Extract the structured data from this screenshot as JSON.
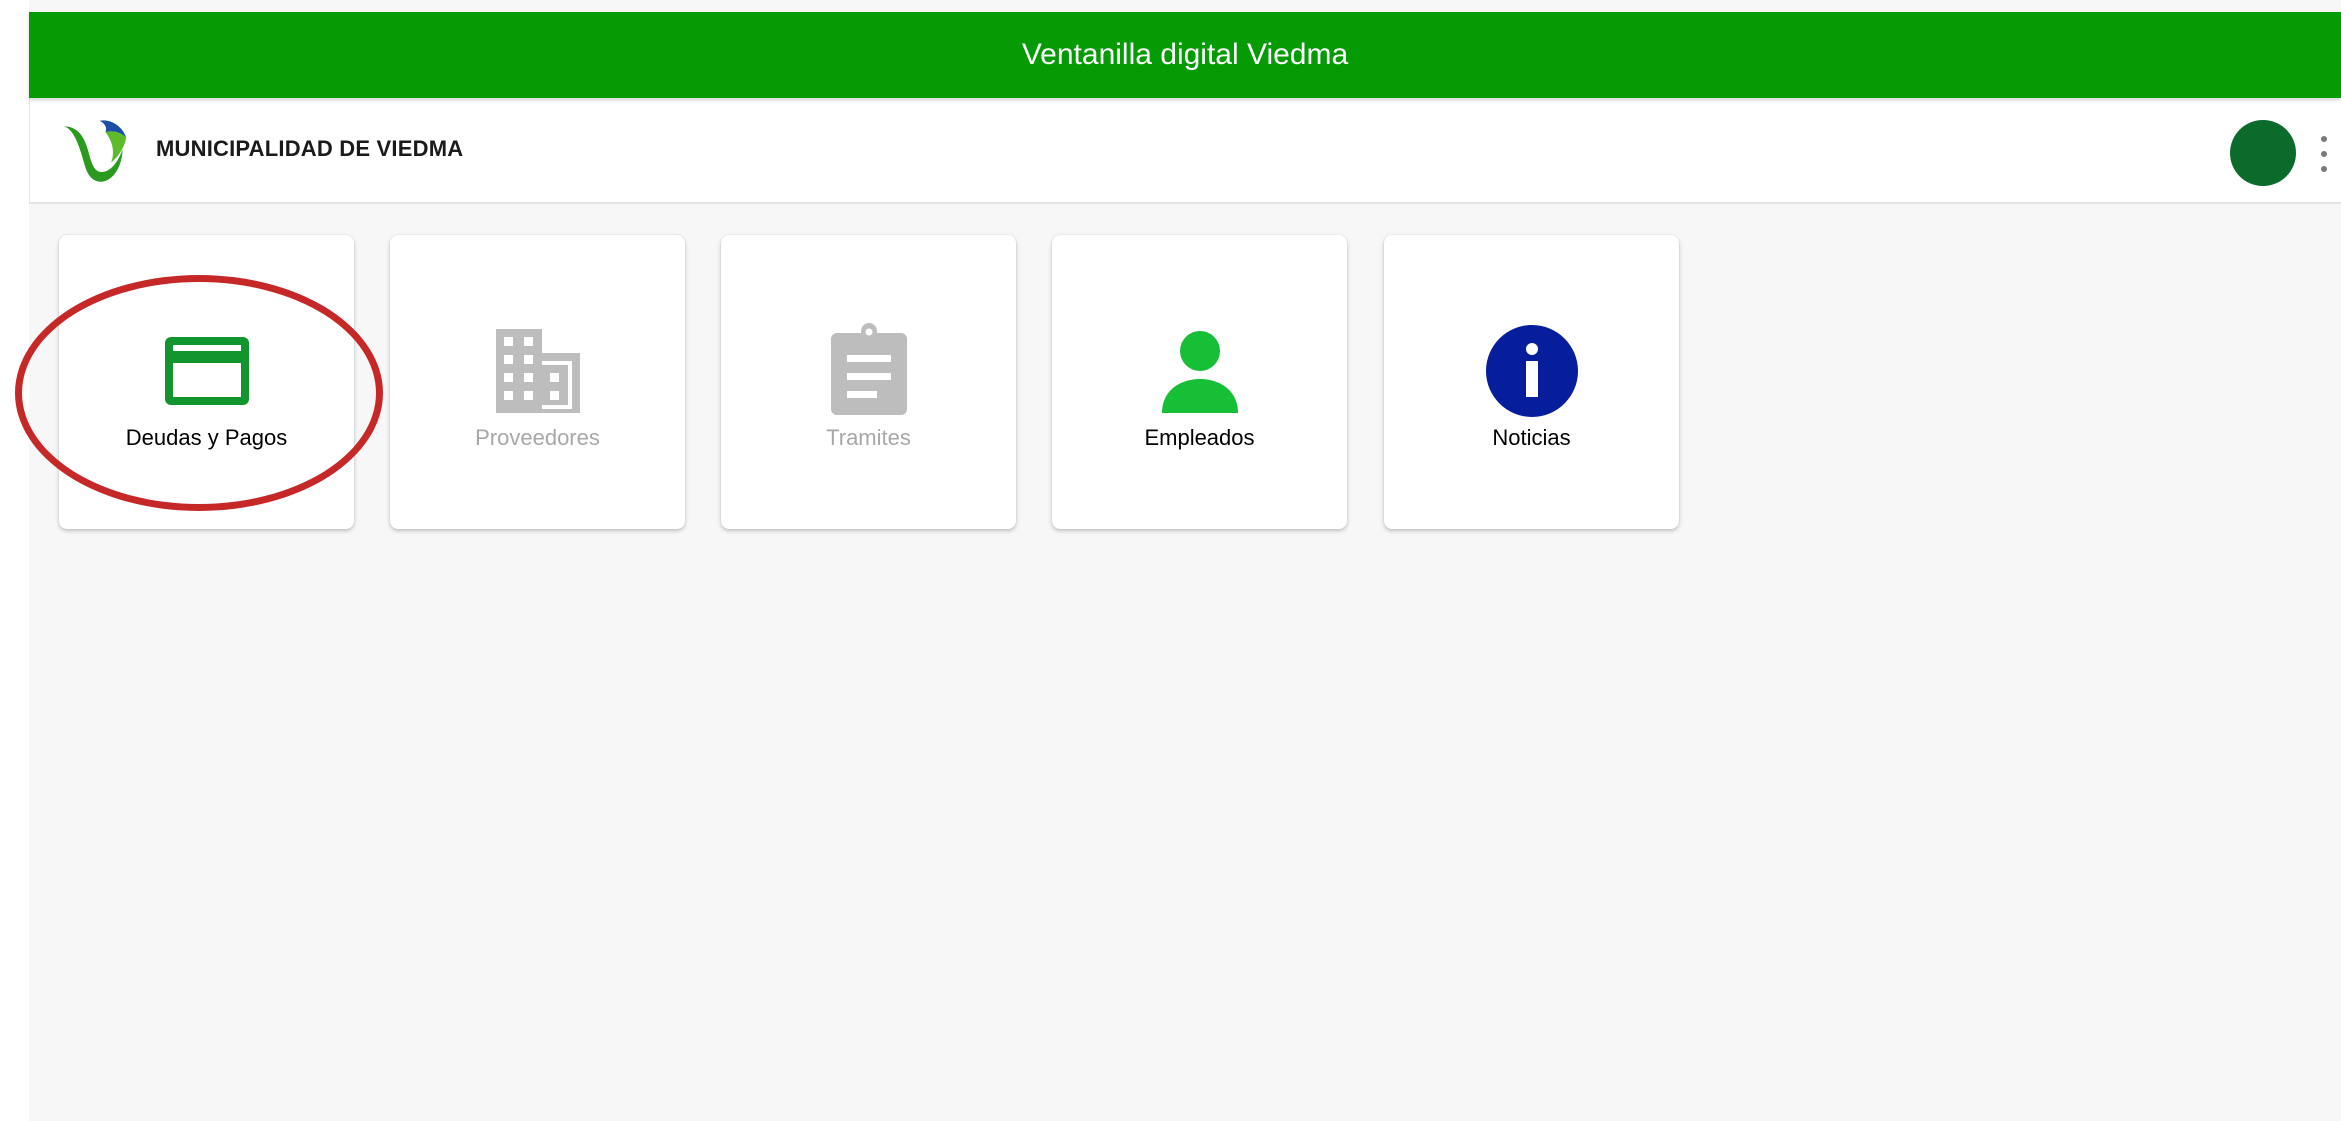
{
  "app": {
    "title": "Ventanilla digital Viedma",
    "title_bar_color": "#049b04",
    "organization": "MUNICIPALIDAD DE VIEDMA",
    "logo_icon": "municipalidad-v-logo",
    "avatar_color": "#0a6b2a",
    "menu_icon": "more-vert-icon"
  },
  "tiles": [
    {
      "label": "Deudas y Pagos",
      "icon": "credit-card-icon",
      "icon_color": "#11962f",
      "state": "enabled",
      "highlighted": true
    },
    {
      "label": "Proveedores",
      "icon": "building-icon",
      "icon_color": "#bdbdbd",
      "state": "disabled"
    },
    {
      "label": "Tramites",
      "icon": "clipboard-icon",
      "icon_color": "#bdbdbd",
      "state": "disabled"
    },
    {
      "label": "Empleados",
      "icon": "person-icon",
      "icon_color": "#16bf36",
      "state": "enabled"
    },
    {
      "label": "Noticias",
      "icon": "info-icon",
      "icon_color": "#061e9c",
      "state": "enabled"
    }
  ],
  "annotation": {
    "shape": "ellipse",
    "color": "#c62828",
    "target": "Deudas y Pagos"
  }
}
